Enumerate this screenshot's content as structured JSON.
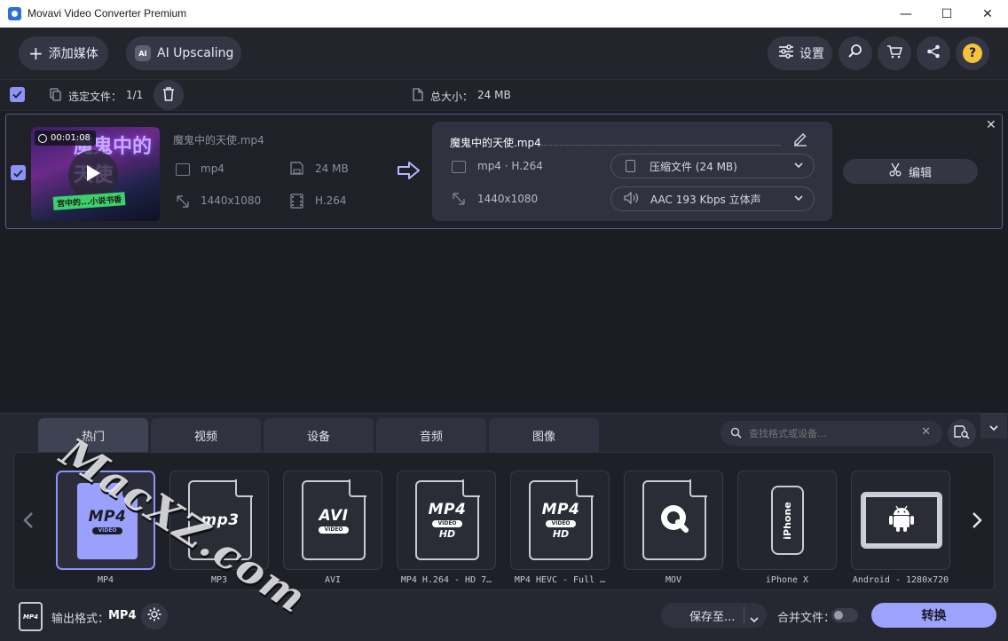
{
  "app": {
    "title": "Movavi Video Converter Premium"
  },
  "window_controls": {
    "minimize": "—",
    "maximize": "☐",
    "close": "✕"
  },
  "toolbar": {
    "add_media": "添加媒体",
    "ai_upscaling": "AI Upscaling",
    "settings": "设置"
  },
  "selection": {
    "selected_label": "选定文件：",
    "selected_value": "1/1",
    "total_label": "总大小：",
    "total_value": "24 MB"
  },
  "file": {
    "duration": "00:01:08",
    "name": "魔鬼中的天使.mp4",
    "container": "mp4",
    "size": "24 MB",
    "resolution": "1440x1080",
    "codec": "H.264",
    "thumb_title": "魔鬼中的天使",
    "thumb_caption": "宫中的...小说书香"
  },
  "output": {
    "name": "魔鬼中的天使.mp4",
    "format": "mp4 · H.264",
    "resolution": "1440x1080",
    "compress": "压缩文件 (24 MB)",
    "audio": "AAC 193 Kbps 立体声",
    "edit_label": "编辑"
  },
  "tabs": [
    "热门",
    "视频",
    "设备",
    "音频",
    "图像"
  ],
  "search": {
    "placeholder": "查找格式或设备..."
  },
  "formats": [
    {
      "label": "MP4"
    },
    {
      "label": "MP3"
    },
    {
      "label": "AVI"
    },
    {
      "label": "MP4 H.264 - HD 7…"
    },
    {
      "label": "MP4 HEVC - Full …"
    },
    {
      "label": "MOV"
    },
    {
      "label": "iPhone X"
    },
    {
      "label": "Android - 1280x720"
    }
  ],
  "format_icons": {
    "mp4": {
      "big": "MP4",
      "pill": "VIDEO"
    },
    "mp3": {
      "big": "mp3"
    },
    "avi": {
      "big": "AVI",
      "pill": "VIDEO"
    },
    "mp4hd": {
      "big": "MP4",
      "pill": "VIDEO",
      "hd": "HD"
    },
    "hevc": {
      "big": "MP4",
      "pill": "VIDEO",
      "hd": "HD"
    },
    "iphone": {
      "text": "iPhone"
    }
  },
  "watermark": "MacXZ.com",
  "footer": {
    "output_label": "输出格式：",
    "output_value": "MP4",
    "output_icon_text": "MP4",
    "save_to": "保存至...",
    "merge_label": "合并文件：",
    "convert": "转换"
  },
  "colors": {
    "accent": "#8d93f7",
    "convert": "#9da3fb",
    "background": "#1c1d24"
  }
}
